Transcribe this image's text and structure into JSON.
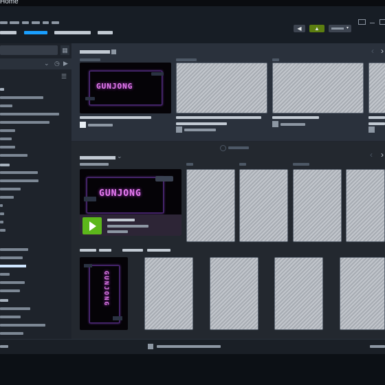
{
  "titlebar": {
    "title": "Home"
  },
  "menubar": {
    "menus": [
      "",
      "",
      "",
      "",
      "",
      ""
    ]
  },
  "navtabs": [
    "",
    "",
    "",
    ""
  ],
  "toolbar": {
    "announce_icon": "megaphone-icon",
    "notify_icon": "bell-icon",
    "account_icon": "account-dropdown-icon"
  },
  "sidebar": {
    "search_placeholder": "",
    "grid_icon": "grid-icon",
    "chevron_icon": "chevron-down-icon",
    "clock_icon": "clock-icon",
    "play_icon": "play-filter-icon",
    "filter_icon": "filter-icon"
  },
  "sections": {
    "recent": {
      "title": "",
      "nav_left": "‹",
      "nav_right": "›",
      "close": "×"
    },
    "add_shelf": {
      "label": ""
    },
    "shelf": {
      "title": "",
      "nav_left": "‹",
      "nav_right": "›",
      "close": "×"
    }
  },
  "featured_game": {
    "logo_text": "GUNJONG",
    "play_icon": "play-icon"
  },
  "colors": {
    "accent": "#1a9fff",
    "play_green": "#5cb71b",
    "brand_green": "#5c7e10",
    "neon": "#e77df0"
  }
}
